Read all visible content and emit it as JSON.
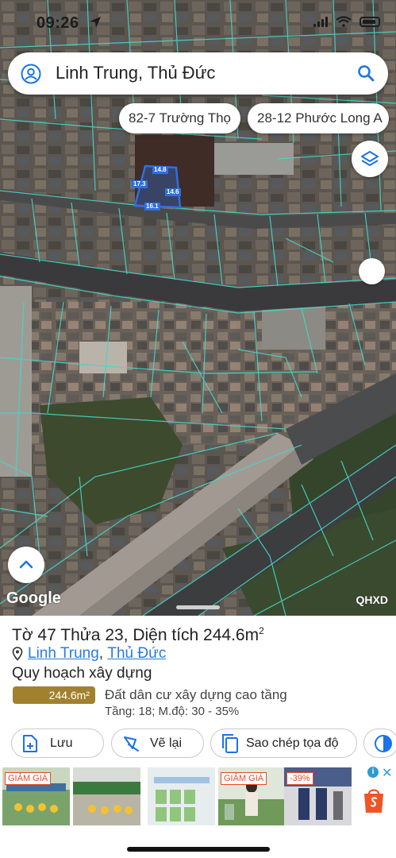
{
  "status_bar": {
    "time": "09:26"
  },
  "search": {
    "query": "Linh Trung, Thủ Đức"
  },
  "chips": [
    {
      "label": "82-7 Trường Thọ"
    },
    {
      "label": "28-12 Phước Long A"
    }
  ],
  "parcel_dims": {
    "top": "14.8",
    "left": "17.3",
    "right": "14.6",
    "bottom": "16.1"
  },
  "map": {
    "attribution": "Google",
    "overlay_label": "QHXD"
  },
  "parcel": {
    "title": "Tờ 47 Thửa 23, Diện tích 244.6m",
    "title_sup": "2",
    "ward": "Linh Trung",
    "separator": ", ",
    "city": "Thủ Đức",
    "planning_heading": "Quy hoạch xây dựng",
    "area_badge": "244.6m²",
    "land_use": "Đất dân cư xây dựng cao tầng",
    "land_detail": "Tầng: 18; M.độ: 30 - 35%"
  },
  "actions": {
    "save": "Lưu",
    "redraw": "Vẽ lại",
    "copy_coords": "Sao chép tọa độ"
  },
  "ads": {
    "tag_sale": "GIẢM GIÁ",
    "tag_discount": "-39%",
    "info": "i",
    "close": "✕"
  },
  "colors": {
    "accent_blue": "#2a7be0",
    "badge_gold": "#a1812d",
    "parcel_line": "#46d6c8",
    "highlight": "#2f6fe0"
  }
}
